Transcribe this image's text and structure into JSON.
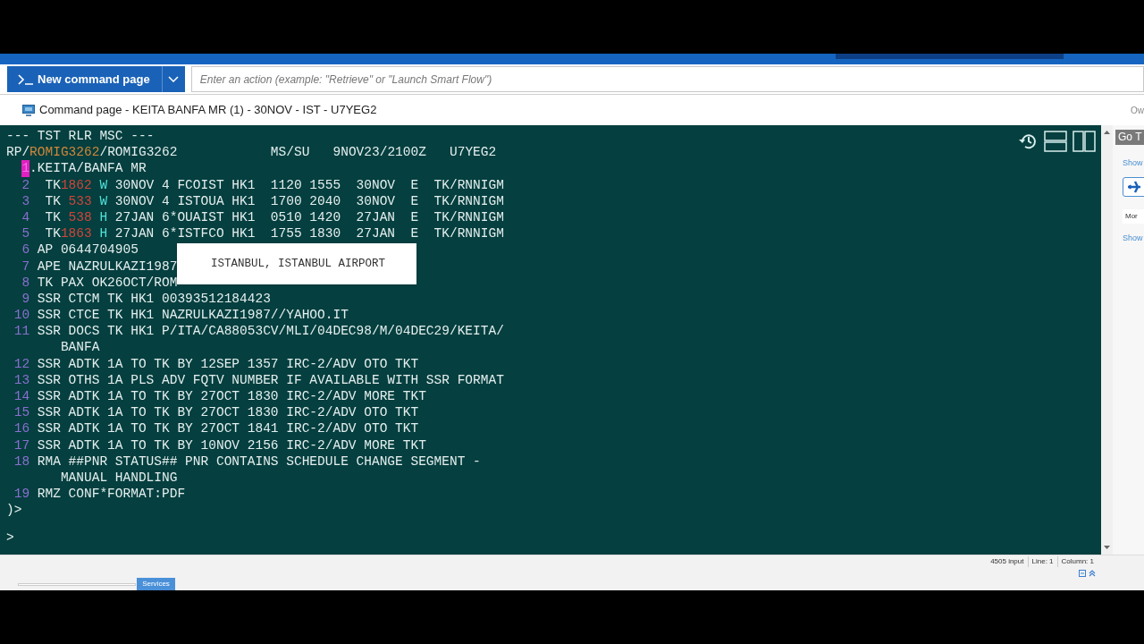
{
  "toolbar": {
    "new_button": "New command page",
    "action_placeholder": "Enter an action (example: \"Retrieve\" or \"Launch Smart Flow\")"
  },
  "page_title": "Command page - KEITA BANFA MR (1) - 30NOV - IST - U7YEG2",
  "title_right": "Ow",
  "terminal": {
    "lines": [
      {
        "segments": [
          {
            "kind": "text",
            "text": "--- TST RLR MSC ---"
          }
        ]
      },
      {
        "segments": [
          {
            "kind": "text",
            "text": "RP/"
          },
          {
            "kind": "office",
            "text": "ROMIG3262"
          },
          {
            "kind": "text",
            "text": "/ROMIG3262            MS/SU   9NOV23/2100Z   U7YEG2"
          }
        ]
      },
      {
        "number": "1",
        "highlighted": true,
        "segments": [
          {
            "kind": "text",
            "text": ".KEITA/BANFA MR"
          }
        ]
      },
      {
        "number": "2",
        "highlighted": false,
        "segments": [
          {
            "kind": "text",
            "text": "  TK"
          },
          {
            "kind": "flight",
            "text": "1862"
          },
          {
            "kind": "class",
            "text": "W"
          },
          {
            "kind": "text",
            "text": " 30NOV 4 FCOIST HK1  1120 1555  30NOV  E  TK/RNNIGM"
          }
        ]
      },
      {
        "number": "3",
        "highlighted": false,
        "segments": [
          {
            "kind": "text",
            "text": "  TK "
          },
          {
            "kind": "flight",
            "text": "533"
          },
          {
            "kind": "class",
            "text": "W"
          },
          {
            "kind": "text",
            "text": " 30NOV 4 ISTOUA HK1  1700 2040  30NOV  E  TK/RNNIGM"
          }
        ]
      },
      {
        "number": "4",
        "highlighted": false,
        "segments": [
          {
            "kind": "text",
            "text": "  TK "
          },
          {
            "kind": "flight",
            "text": "538"
          },
          {
            "kind": "class",
            "text": "H"
          },
          {
            "kind": "text",
            "text": " 27JAN 6*OUAIST HK1  0510 1420  27JAN  E  TK/RNNIGM"
          }
        ]
      },
      {
        "number": "5",
        "highlighted": false,
        "segments": [
          {
            "kind": "text",
            "text": "  TK"
          },
          {
            "kind": "flight",
            "text": "1863"
          },
          {
            "kind": "class",
            "text": "H"
          },
          {
            "kind": "text",
            "text": " 27JAN 6*ISTFCO HK1  1755 1830  27JAN  E  TK/RNNIGM"
          }
        ]
      },
      {
        "number": "6",
        "highlighted": false,
        "segments": [
          {
            "kind": "text",
            "text": " AP 0644704905"
          }
        ]
      },
      {
        "number": "7",
        "highlighted": false,
        "segments": [
          {
            "kind": "text",
            "text": " APE NAZRULKAZI1987"
          }
        ]
      },
      {
        "number": "8",
        "highlighted": false,
        "segments": [
          {
            "kind": "text",
            "text": " TK PAX OK26OCT/ROM"
          }
        ]
      },
      {
        "number": "9",
        "highlighted": false,
        "segments": [
          {
            "kind": "text",
            "text": " SSR CTCM TK HK1 00393512184423"
          }
        ]
      },
      {
        "number": "10",
        "highlighted": false,
        "segments": [
          {
            "kind": "text",
            "text": " SSR CTCE TK HK1 NAZRULKAZI1987//YAHOO.IT"
          }
        ]
      },
      {
        "number": "11",
        "highlighted": false,
        "segments": [
          {
            "kind": "text",
            "text": " SSR DOCS TK HK1 P/ITA/CA88053CV/MLI/04DEC98/M/04DEC29/KEITA/"
          }
        ],
        "continuation": "BANFA"
      },
      {
        "number": "12",
        "highlighted": false,
        "segments": [
          {
            "kind": "text",
            "text": " SSR ADTK 1A TO TK BY 12SEP 1357 IRC-2/ADV OTO TKT"
          }
        ]
      },
      {
        "number": "13",
        "highlighted": false,
        "segments": [
          {
            "kind": "text",
            "text": " SSR OTHS 1A PLS ADV FQTV NUMBER IF AVAILABLE WITH SSR FORMAT"
          }
        ]
      },
      {
        "number": "14",
        "highlighted": false,
        "segments": [
          {
            "kind": "text",
            "text": " SSR ADTK 1A TO TK BY 27OCT 1830 IRC-2/ADV MORE TKT"
          }
        ]
      },
      {
        "number": "15",
        "highlighted": false,
        "segments": [
          {
            "kind": "text",
            "text": " SSR ADTK 1A TO TK BY 27OCT 1830 IRC-2/ADV OTO TKT"
          }
        ]
      },
      {
        "number": "16",
        "highlighted": false,
        "segments": [
          {
            "kind": "text",
            "text": " SSR ADTK 1A TO TK BY 27OCT 1841 IRC-2/ADV OTO TKT"
          }
        ]
      },
      {
        "number": "17",
        "highlighted": false,
        "segments": [
          {
            "kind": "text",
            "text": " SSR ADTK 1A TO TK BY 10NOV 2156 IRC-2/ADV MORE TKT"
          }
        ]
      },
      {
        "number": "18",
        "highlighted": false,
        "segments": [
          {
            "kind": "text",
            "text": " RMA ##PNR STATUS## PNR CONTAINS SCHEDULE CHANGE SEGMENT -"
          }
        ],
        "continuation": "MANUAL HANDLING"
      },
      {
        "number": "19",
        "highlighted": false,
        "segments": [
          {
            "kind": "text",
            "text": " RMZ CONF*FORMAT:PDF"
          }
        ]
      },
      {
        "segments": [
          {
            "kind": "text",
            "text": ")>"
          }
        ]
      }
    ],
    "input_prompt": ">",
    "tooltip": "ISTANBUL, ISTANBUL AIRPORT"
  },
  "side_panel": {
    "header": "Go T",
    "link_1": "Show",
    "button": "Mor",
    "link_2": "Show"
  },
  "status_bar": [
    "4505 input",
    "Line: 1",
    "Column: 1"
  ],
  "bottom_tab": "Services"
}
